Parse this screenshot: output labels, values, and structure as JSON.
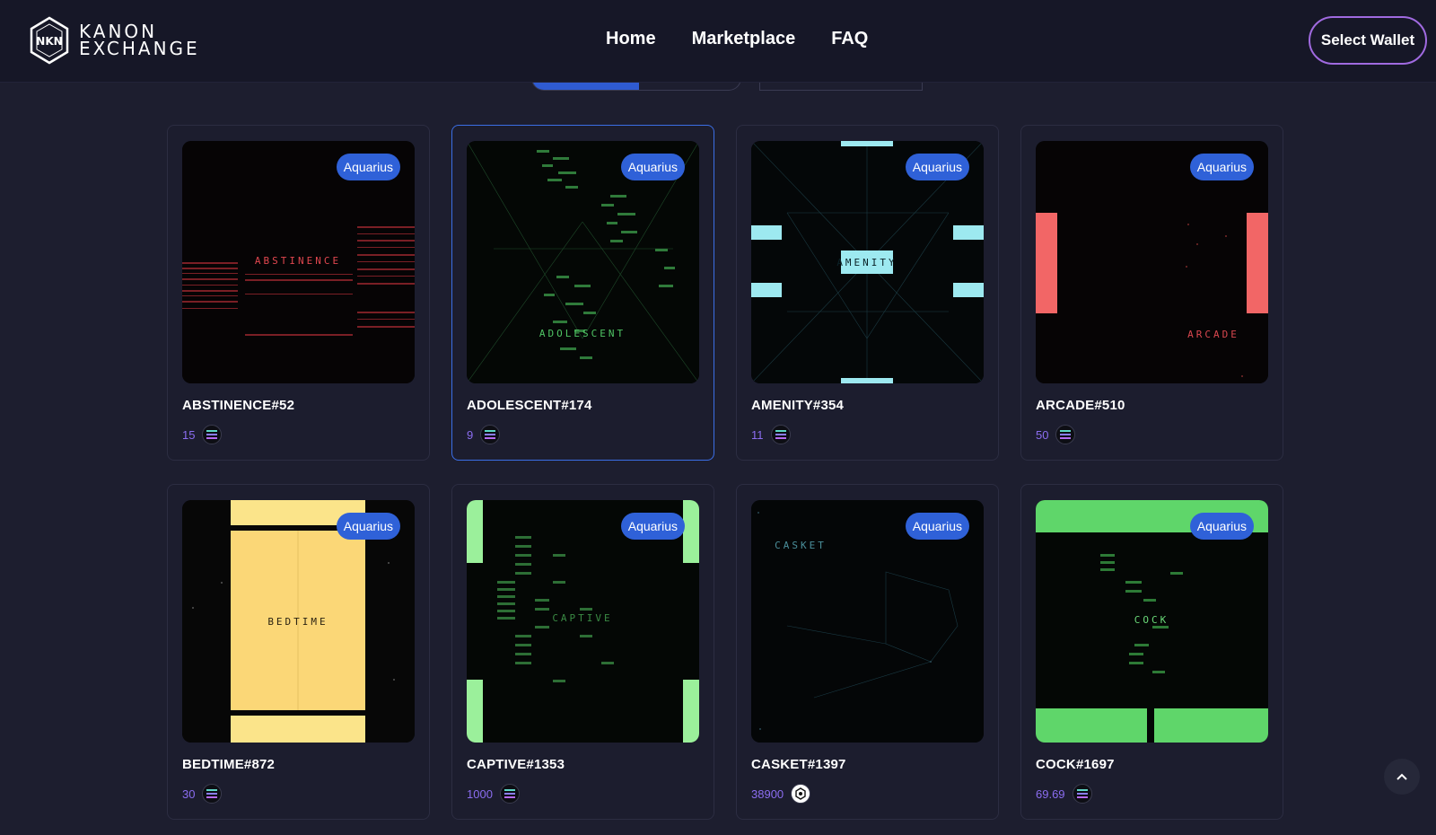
{
  "brand": {
    "line1": "KANON",
    "line2": "EXCHANGE"
  },
  "nav": {
    "items": [
      "Home",
      "Marketplace",
      "FAQ"
    ]
  },
  "wallet": {
    "label": "Select Wallet"
  },
  "cards": [
    {
      "name": "ABSTINENCE#52",
      "price": "15",
      "badge": "Aquarius",
      "art_text": "ABSTINENCE",
      "currency_icon": "solana-icon"
    },
    {
      "name": "ADOLESCENT#174",
      "price": "9",
      "badge": "Aquarius",
      "art_text": "ADOLESCENT",
      "currency_icon": "solana-icon"
    },
    {
      "name": "AMENITY#354",
      "price": "11",
      "badge": "Aquarius",
      "art_text": "AMENITY",
      "currency_icon": "solana-icon"
    },
    {
      "name": "ARCADE#510",
      "price": "50",
      "badge": "Aquarius",
      "art_text": "ARCADE",
      "currency_icon": "solana-icon"
    },
    {
      "name": "BEDTIME#872",
      "price": "30",
      "badge": "Aquarius",
      "art_text": "BEDTIME",
      "currency_icon": "solana-icon"
    },
    {
      "name": "CAPTIVE#1353",
      "price": "1000",
      "badge": "Aquarius",
      "art_text": "CAPTIVE",
      "currency_icon": "solana-icon"
    },
    {
      "name": "CASKET#1397",
      "price": "38900",
      "badge": "Aquarius",
      "art_text": "CASKET",
      "currency_icon": "kanon-token-icon"
    },
    {
      "name": "COCK#1697",
      "price": "69.69",
      "badge": "Aquarius",
      "art_text": "COCK",
      "currency_icon": "solana-icon"
    }
  ],
  "colors": {
    "background": "#1d1e2f",
    "header": "#161727",
    "accent_blue": "#2f61d8",
    "price_purple": "#8b6df0",
    "wallet_border": "#a06ae0"
  }
}
